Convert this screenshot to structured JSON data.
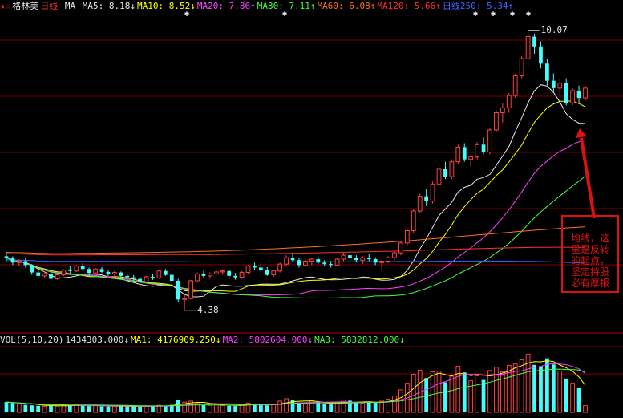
{
  "header": {
    "stock_icon": "star-icons",
    "stock_name": "格林美",
    "period": "日线",
    "ma_label": "MA",
    "items": [
      {
        "text": "MA5: 8.18",
        "arrow": "↓",
        "color": "#e8e8e8"
      },
      {
        "text": "MA10: 8.52",
        "arrow": "↓",
        "color": "#ffff00"
      },
      {
        "text": "MA20: 7.86",
        "arrow": "↑",
        "color": "#ff40ff"
      },
      {
        "text": "MA30: 7.11",
        "arrow": "↑",
        "color": "#40ff40"
      },
      {
        "text": "MA60: 6.08",
        "arrow": "↑",
        "color": "#ff7020"
      },
      {
        "text": "MA120: 5.66",
        "arrow": "↑",
        "color": "#ff3030"
      },
      {
        "text": "日线250: 5.34",
        "arrow": "↑",
        "color": "#4060ff"
      }
    ]
  },
  "volume_header": {
    "items": [
      {
        "text": "VOL(5,10,20)",
        "color": "#e0e0e0"
      },
      {
        "text": "1434303.000",
        "arrow": "↓",
        "color": "#e0e0e0"
      },
      {
        "text": "MA1: 4176909.250",
        "arrow": "↓",
        "color": "#ffff00"
      },
      {
        "text": "MA2: 5802604.000",
        "arrow": "↓",
        "color": "#ff40ff"
      },
      {
        "text": "MA3: 5832812.000",
        "arrow": "↓",
        "color": "#40ff40"
      }
    ]
  },
  "price_labels": {
    "high": "10.07",
    "low": "4.38"
  },
  "annotation": {
    "text": "均线，这里是反转的起点，坚定持股必有厚报"
  },
  "colors": {
    "up": "#ff4040",
    "down": "#40ffff",
    "grid": "#800000",
    "annotation": "#e01010"
  },
  "chart_data": [
    {
      "type": "candlestick",
      "title": "格林美 日线",
      "ylim": [
        4.0,
        10.4
      ],
      "ohlc": [
        [
          5.48,
          5.55,
          5.38,
          5.45
        ],
        [
          5.45,
          5.48,
          5.3,
          5.35
        ],
        [
          5.35,
          5.42,
          5.28,
          5.38
        ],
        [
          5.38,
          5.45,
          5.25,
          5.3
        ],
        [
          5.3,
          5.32,
          5.1,
          5.15
        ],
        [
          5.15,
          5.2,
          5.02,
          5.08
        ],
        [
          5.08,
          5.18,
          5.04,
          5.12
        ],
        [
          5.12,
          5.14,
          4.98,
          5.02
        ],
        [
          5.02,
          5.12,
          5.0,
          5.1
        ],
        [
          5.1,
          5.22,
          5.08,
          5.2
        ],
        [
          5.2,
          5.28,
          5.12,
          5.18
        ],
        [
          5.18,
          5.3,
          5.16,
          5.28
        ],
        [
          5.28,
          5.34,
          5.18,
          5.22
        ],
        [
          5.22,
          5.25,
          5.1,
          5.14
        ],
        [
          5.14,
          5.24,
          5.12,
          5.22
        ],
        [
          5.22,
          5.26,
          5.14,
          5.16
        ],
        [
          5.16,
          5.2,
          5.08,
          5.12
        ],
        [
          5.12,
          5.18,
          5.06,
          5.15
        ],
        [
          5.15,
          5.17,
          5.05,
          5.08
        ],
        [
          5.08,
          5.12,
          5.0,
          5.05
        ],
        [
          5.05,
          5.1,
          4.98,
          5.02
        ],
        [
          5.02,
          5.06,
          4.92,
          4.96
        ],
        [
          4.96,
          5.08,
          4.94,
          5.06
        ],
        [
          5.06,
          5.12,
          5.0,
          5.04
        ],
        [
          5.04,
          5.2,
          5.02,
          5.18
        ],
        [
          5.18,
          5.22,
          5.08,
          5.1
        ],
        [
          5.1,
          5.12,
          4.95,
          4.98
        ],
        [
          4.98,
          5.02,
          4.55,
          4.6
        ],
        [
          4.6,
          4.7,
          4.38,
          4.62
        ],
        [
          4.62,
          5.0,
          4.6,
          4.98
        ],
        [
          4.98,
          5.15,
          4.95,
          5.12
        ],
        [
          5.12,
          5.18,
          5.05,
          5.08
        ],
        [
          5.08,
          5.15,
          5.02,
          5.12
        ],
        [
          5.12,
          5.2,
          5.08,
          5.16
        ],
        [
          5.16,
          5.22,
          5.1,
          5.18
        ],
        [
          5.18,
          5.2,
          5.04,
          5.08
        ],
        [
          5.08,
          5.14,
          5.0,
          5.05
        ],
        [
          5.05,
          5.18,
          5.02,
          5.15
        ],
        [
          5.15,
          5.3,
          5.12,
          5.28
        ],
        [
          5.28,
          5.35,
          5.2,
          5.25
        ],
        [
          5.25,
          5.32,
          5.15,
          5.2
        ],
        [
          5.2,
          5.26,
          5.08,
          5.1
        ],
        [
          5.1,
          5.2,
          5.06,
          5.18
        ],
        [
          5.18,
          5.35,
          5.15,
          5.32
        ],
        [
          5.32,
          5.5,
          5.28,
          5.45
        ],
        [
          5.45,
          5.55,
          5.35,
          5.4
        ],
        [
          5.4,
          5.45,
          5.25,
          5.3
        ],
        [
          5.3,
          5.42,
          5.26,
          5.38
        ],
        [
          5.38,
          5.45,
          5.3,
          5.42
        ],
        [
          5.42,
          5.48,
          5.32,
          5.35
        ],
        [
          5.35,
          5.4,
          5.28,
          5.32
        ],
        [
          5.32,
          5.38,
          5.25,
          5.3
        ],
        [
          5.3,
          5.45,
          5.28,
          5.42
        ],
        [
          5.42,
          5.55,
          5.38,
          5.5
        ],
        [
          5.5,
          5.58,
          5.4,
          5.45
        ],
        [
          5.45,
          5.5,
          5.35,
          5.4
        ],
        [
          5.4,
          5.48,
          5.32,
          5.45
        ],
        [
          5.45,
          5.52,
          5.38,
          5.42
        ],
        [
          5.42,
          5.46,
          5.3,
          5.35
        ],
        [
          5.35,
          5.4,
          5.2,
          5.38
        ],
        [
          5.38,
          5.48,
          5.34,
          5.45
        ],
        [
          5.45,
          5.58,
          5.4,
          5.55
        ],
        [
          5.55,
          5.8,
          5.5,
          5.75
        ],
        [
          5.75,
          6.05,
          5.7,
          6.0
        ],
        [
          6.0,
          6.45,
          5.95,
          6.4
        ],
        [
          6.4,
          6.75,
          6.35,
          6.7
        ],
        [
          6.7,
          6.85,
          6.5,
          6.6
        ],
        [
          6.6,
          7.0,
          6.55,
          6.95
        ],
        [
          6.95,
          7.3,
          6.9,
          7.25
        ],
        [
          7.25,
          7.4,
          7.05,
          7.1
        ],
        [
          7.1,
          7.45,
          7.05,
          7.4
        ],
        [
          7.4,
          7.75,
          7.35,
          7.7
        ],
        [
          7.7,
          7.78,
          7.4,
          7.45
        ],
        [
          7.45,
          7.55,
          7.3,
          7.5
        ],
        [
          7.5,
          7.8,
          7.45,
          7.75
        ],
        [
          7.75,
          7.9,
          7.55,
          7.6
        ],
        [
          7.6,
          8.1,
          7.55,
          8.05
        ],
        [
          8.05,
          8.45,
          8.0,
          8.4
        ],
        [
          8.4,
          8.6,
          8.2,
          8.5
        ],
        [
          8.5,
          8.8,
          8.4,
          8.75
        ],
        [
          8.75,
          9.2,
          8.7,
          9.15
        ],
        [
          9.15,
          9.55,
          9.1,
          9.5
        ],
        [
          9.5,
          10.07,
          9.35,
          9.95
        ],
        [
          9.95,
          10.0,
          9.6,
          9.75
        ],
        [
          9.75,
          9.85,
          9.3,
          9.4
        ],
        [
          9.4,
          9.5,
          8.95,
          9.05
        ],
        [
          9.05,
          9.2,
          8.8,
          8.9
        ],
        [
          8.9,
          9.1,
          8.75,
          9.0
        ],
        [
          9.0,
          9.1,
          8.55,
          8.6
        ],
        [
          8.6,
          8.9,
          8.55,
          8.85
        ],
        [
          8.85,
          8.95,
          8.6,
          8.7
        ],
        [
          8.7,
          8.95,
          8.65,
          8.9
        ]
      ],
      "ma_series": [
        {
          "name": "MA5",
          "color": "#e8e8e8",
          "period": 5
        },
        {
          "name": "MA10",
          "color": "#ffff00",
          "period": 10
        },
        {
          "name": "MA20",
          "color": "#ff40ff",
          "period": 20
        },
        {
          "name": "MA30",
          "color": "#40ff40",
          "period": 30
        },
        {
          "name": "MA60",
          "color": "#ff7020",
          "period": 60
        },
        {
          "name": "MA120",
          "color": "#ff3030",
          "period": 120
        },
        {
          "name": "日线250",
          "color": "#4060ff",
          "period": 250
        }
      ],
      "ma_start": {
        "MA5": 5.45,
        "MA10": 5.42,
        "MA20": 5.55,
        "MA30": 5.6,
        "MA60": 5.58,
        "MA120": 5.55,
        "日线250": 5.4
      },
      "ma_end": {
        "MA5": 8.18,
        "MA10": 8.52,
        "MA20": 7.86,
        "MA30": 7.11,
        "MA60": 6.08,
        "MA120": 5.66,
        "日线250": 5.34
      }
    },
    {
      "type": "bar",
      "title": "VOL(5,10,20)",
      "ylim": [
        0,
        14000000
      ],
      "values": [
        2200000,
        2000000,
        1800000,
        1600000,
        1500000,
        1400000,
        1300000,
        1450000,
        1350000,
        1500000,
        1400000,
        1600000,
        1550000,
        1350000,
        1450000,
        1300000,
        1250000,
        1400000,
        1350000,
        1200000,
        1300000,
        1250000,
        1350000,
        1400000,
        1500000,
        1350000,
        1600000,
        2600000,
        2200000,
        2400000,
        1900000,
        1600000,
        1500000,
        1700000,
        1450000,
        1400000,
        1350000,
        1650000,
        2000000,
        1700000,
        1600000,
        1500000,
        1800000,
        2400000,
        2900000,
        2700000,
        2100000,
        2000000,
        2500000,
        2200000,
        1800000,
        1700000,
        2000000,
        2600000,
        2500000,
        2100000,
        1900000,
        2300000,
        2100000,
        2400000,
        2800000,
        3500000,
        4800000,
        6200000,
        8100000,
        9000000,
        7300000,
        8600000,
        8800000,
        6400000,
        7700000,
        9800000,
        8500000,
        6700000,
        7800000,
        6900000,
        8900000,
        9600000,
        8600000,
        10000000,
        10300000,
        11200000,
        12400000,
        10100000,
        9800000,
        11500000,
        10200000,
        8800000,
        7200000,
        6200000,
        5200000,
        1434303
      ]
    }
  ]
}
